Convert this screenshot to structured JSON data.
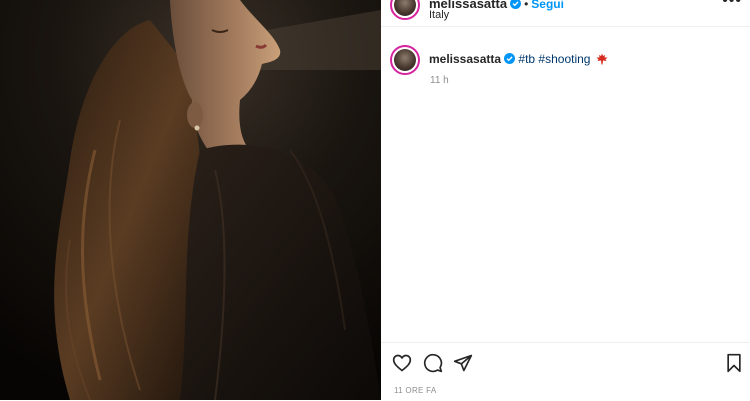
{
  "post": {
    "username": "melissasatta",
    "location": "Italy",
    "follow_label": "Segui",
    "separator": "•",
    "more_label": "•••"
  },
  "caption": {
    "username": "melissasatta",
    "hashtags": [
      "#tb",
      "#shooting"
    ],
    "emoji": "maple-leaf-icon",
    "time_ago": "11 h"
  },
  "footer": {
    "date_label": "11 ORE FA"
  },
  "icons": {
    "like": "heart-icon",
    "comment": "comment-icon",
    "share": "paper-plane-icon",
    "save": "bookmark-icon",
    "verified": "verified-badge-icon"
  },
  "colors": {
    "link_blue": "#0095f6",
    "hashtag": "#00376b",
    "story_ring": "#d6249f",
    "muted": "#8e8e8e"
  }
}
